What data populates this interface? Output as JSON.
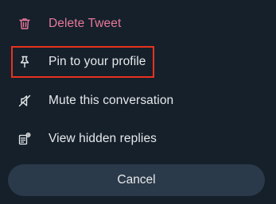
{
  "menu": {
    "items": [
      {
        "label": "Delete Tweet",
        "icon": "trash-icon",
        "color": "#e8789a"
      },
      {
        "label": "Pin to your profile",
        "icon": "pin-icon",
        "color": "#e7e9ea"
      },
      {
        "label": "Mute this conversation",
        "icon": "mute-icon",
        "color": "#e7e9ea"
      },
      {
        "label": "View hidden replies",
        "icon": "hidden-replies-icon",
        "color": "#e7e9ea"
      }
    ]
  },
  "cancel_label": "Cancel",
  "colors": {
    "background": "#15202b",
    "cancel_background": "#2b3a4a",
    "highlight": "#e8321f"
  }
}
